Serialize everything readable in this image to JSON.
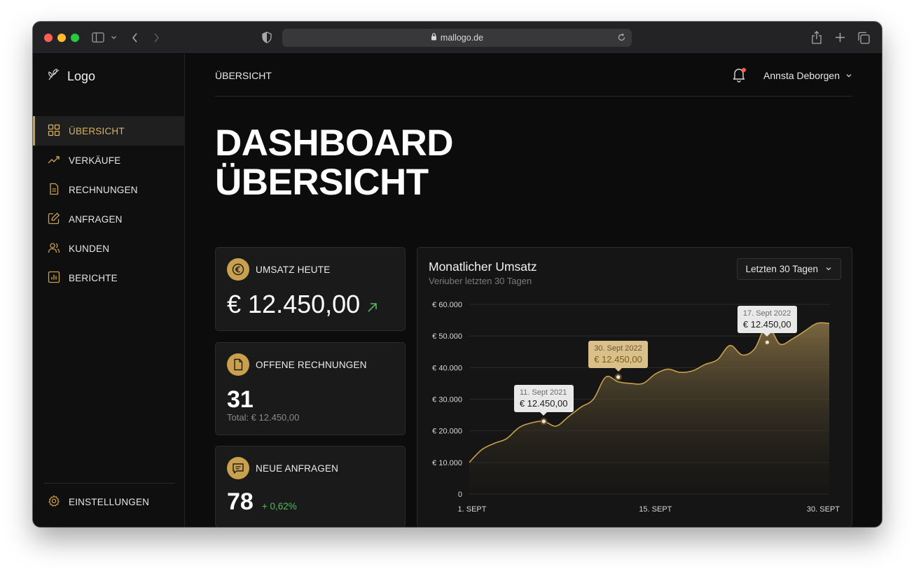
{
  "browser": {
    "url": "mallogo.de"
  },
  "sidebar": {
    "logo": "Logo",
    "items": [
      {
        "label": "ÜBERSICHT",
        "icon": "grid-icon",
        "active": true
      },
      {
        "label": "VERKÄUFE",
        "icon": "trending-up-icon"
      },
      {
        "label": "RECHNUNGEN",
        "icon": "document-icon"
      },
      {
        "label": "ANFRAGEN",
        "icon": "edit-icon"
      },
      {
        "label": "KUNDEN",
        "icon": "users-icon"
      },
      {
        "label": "BERICHTE",
        "icon": "report-icon"
      }
    ],
    "settings": "EINSTELLUNGEN"
  },
  "header": {
    "breadcrumb": "ÜBERSICHT",
    "user_name": "Annsta Deborgen"
  },
  "page": {
    "title_line1": "DASHBOARD",
    "title_line2": "ÜBERSICHT"
  },
  "cards": {
    "revenue_today": {
      "label": "UMSATZ HEUTE",
      "value": "€ 12.450,00",
      "icon": "euro-icon"
    },
    "open_invoices": {
      "label": "OFFENE RECHNUNGEN",
      "value": "31",
      "sub": "Total: € 12.450,00",
      "icon": "document-icon"
    },
    "new_requests": {
      "label": "NEUE ANFRAGEN",
      "value": "78",
      "change": "+ 0,62%",
      "icon": "chat-icon"
    }
  },
  "colors": {
    "accent": "#c9a14e",
    "positive": "#4fbb5f",
    "background": "#0c0c0c"
  },
  "chart_panel": {
    "title": "Monatlicher Umsatz",
    "subtitle": "Verɨuber letzten 30 Tagen",
    "range": "Letzten 30 Tagen",
    "tooltips": [
      {
        "date": "11. Sept 2021",
        "value": "€ 12.450,00",
        "style": "light"
      },
      {
        "date": "30. Sept 2022",
        "value": "€ 12.450,00",
        "style": "gold"
      },
      {
        "date": "17. Sept 2022",
        "value": "€ 12.450,00",
        "style": "light"
      }
    ]
  },
  "chart_data": {
    "type": "area",
    "title": "Monatlicher Umsatz",
    "y_ticks": [
      "€ 60.000",
      "€ 50.000",
      "€ 40.000",
      "€ 30.000",
      "€ 20.000",
      "€ 10.000",
      "0"
    ],
    "x_ticks": [
      "1. SEPT",
      "15. SEPT",
      "30. SEPT"
    ],
    "ylim": [
      0,
      60000
    ],
    "xlim": [
      1,
      30
    ],
    "grid": true,
    "series": [
      {
        "x": [
          1,
          2,
          3,
          4,
          5,
          6,
          7,
          8,
          9,
          10,
          11,
          12,
          13,
          14,
          15,
          16,
          17,
          18,
          19,
          20,
          21,
          22,
          23,
          24,
          25,
          26,
          27,
          28,
          29,
          30
        ],
        "values": [
          10000,
          14000,
          16000,
          17500,
          21000,
          22500,
          23000,
          21500,
          24500,
          27500,
          30000,
          37000,
          35500,
          35000,
          35000,
          38000,
          39500,
          38500,
          39000,
          41000,
          42500,
          47000,
          44000,
          46000,
          53500,
          47500,
          49000,
          51500,
          54000,
          54000
        ]
      }
    ],
    "highlighted_points": [
      {
        "x": 7,
        "y": 23000
      },
      {
        "x": 13,
        "y": 37000
      },
      {
        "x": 25,
        "y": 48000
      }
    ]
  }
}
